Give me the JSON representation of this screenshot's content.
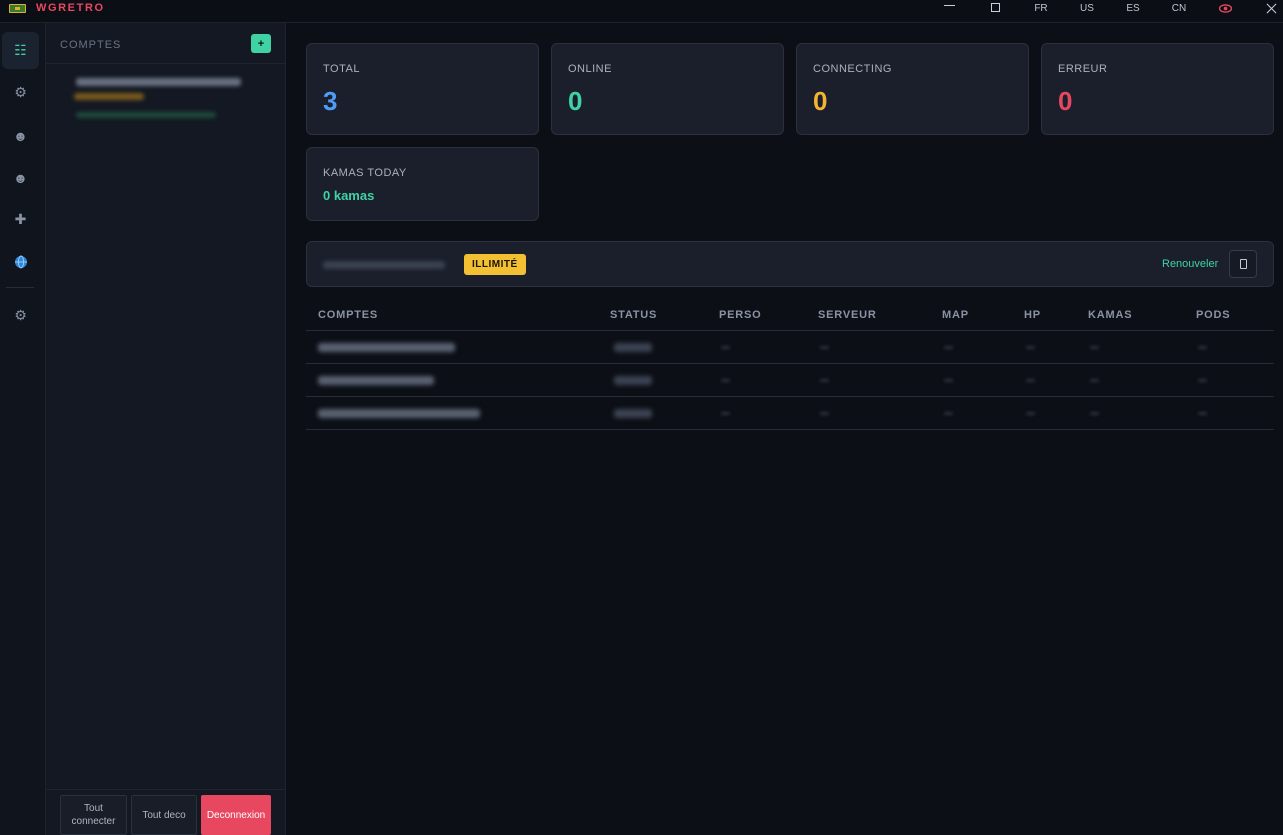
{
  "app": {
    "title": "WGRETRO",
    "accent_color": "#e8485f",
    "languages": [
      "FR",
      "US",
      "ES",
      "CN"
    ],
    "window_buttons": [
      "minimize-icon",
      "maximize-icon",
      "close-icon"
    ],
    "eye_icon_color": "#e8485f"
  },
  "rail": {
    "items": [
      {
        "name": "dashboard",
        "icon": "dashboard-icon",
        "glyph": "☷",
        "active": true
      },
      {
        "name": "settings",
        "icon": "gear-icon",
        "glyph": "⚙",
        "active": false
      },
      {
        "name": "character",
        "icon": "character-icon",
        "glyph": "☻",
        "active": false
      },
      {
        "name": "group",
        "icon": "group-icon",
        "glyph": "☻",
        "active": false
      },
      {
        "name": "add",
        "icon": "plus-icon",
        "glyph": "✚",
        "active": false
      },
      {
        "name": "globe",
        "icon": "globe-icon",
        "glyph": "●",
        "active": false
      },
      {
        "name": "preferences",
        "icon": "gear-icon",
        "glyph": "⚙",
        "active": false
      }
    ]
  },
  "accounts_panel": {
    "title": "COMPTES",
    "add_label": "+",
    "buttons": {
      "connect_all": "Tout connecter",
      "disconnect_all": "Tout deco",
      "logout": "Deconnexion"
    }
  },
  "stats": {
    "total": {
      "label": "TOTAL",
      "value": "3",
      "color": "#4f9cf7"
    },
    "online": {
      "label": "ONLINE",
      "value": "0",
      "color": "#3fd3a4"
    },
    "connecting": {
      "label": "CONNECTING",
      "value": "0",
      "color": "#f2b532"
    },
    "error": {
      "label": "ERREUR",
      "value": "0",
      "color": "#e8485f"
    },
    "kamas_today": {
      "label": "KAMAS TODAY",
      "value": "0 kamas"
    }
  },
  "license": {
    "badge": "ILLIMITÉ",
    "renew_label": "Renouveler",
    "copy_icon": "copy-icon"
  },
  "table": {
    "columns": [
      "COMPTES",
      "STATUS",
      "PERSO",
      "SERVEUR",
      "MAP",
      "HP",
      "KAMAS",
      "PODS"
    ]
  }
}
